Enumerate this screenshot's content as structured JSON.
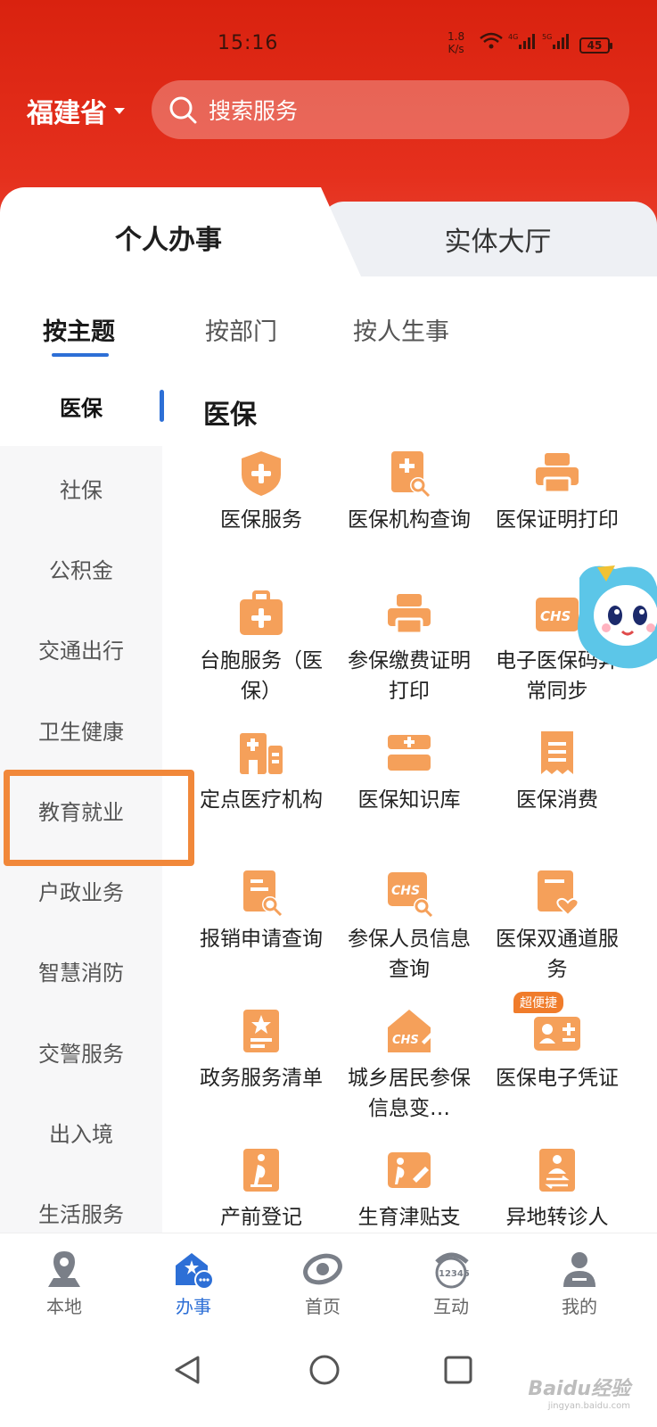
{
  "status": {
    "time": "15:16",
    "speed_top": "1.8",
    "speed_bottom": "K/s",
    "battery": "45"
  },
  "header": {
    "province": "福建省",
    "search_placeholder": "搜索服务"
  },
  "top_tabs": {
    "personal": "个人办事",
    "hall": "实体大厅"
  },
  "sub_tabs": [
    "按主题",
    "按部门",
    "按人生事"
  ],
  "sidebar": [
    "医保",
    "社保",
    "公积金",
    "交通出行",
    "卫生健康",
    "教育就业",
    "户政业务",
    "智慧消防",
    "交警服务",
    "出入境",
    "生活服务"
  ],
  "section_title": "医保",
  "services": [
    {
      "label": "医保服务",
      "icon": "shield-plus-icon"
    },
    {
      "label": "医保机构查询",
      "icon": "document-search-icon"
    },
    {
      "label": "医保证明打印",
      "icon": "printer-icon"
    },
    {
      "label": "台胞服务（医保）",
      "icon": "medical-kit-icon"
    },
    {
      "label": "参保缴费证明打印",
      "icon": "printer-icon"
    },
    {
      "label": "电子医保码异常同步",
      "icon": "chs-card-icon"
    },
    {
      "label": "定点医疗机构",
      "icon": "hospital-icon"
    },
    {
      "label": "医保知识库",
      "icon": "book-stack-icon"
    },
    {
      "label": "医保消费",
      "icon": "receipt-icon"
    },
    {
      "label": "报销申请查询",
      "icon": "document-search-icon"
    },
    {
      "label": "参保人员信息查询",
      "icon": "chs-search-icon"
    },
    {
      "label": "医保双通道服务",
      "icon": "document-heart-icon"
    },
    {
      "label": "政务服务清单",
      "icon": "star-list-icon"
    },
    {
      "label": "城乡居民参保信息变…",
      "icon": "chs-edit-icon"
    },
    {
      "label": "医保电子凭证",
      "icon": "id-card-icon",
      "badge": "超便捷"
    },
    {
      "label": "产前登记",
      "icon": "pregnancy-icon"
    },
    {
      "label": "生育津贴支",
      "icon": "pregnancy-edit-icon"
    },
    {
      "label": "异地转诊人",
      "icon": "person-transfer-icon"
    }
  ],
  "bottom_nav": [
    "本地",
    "办事",
    "首页",
    "互动",
    "我的"
  ],
  "watermark": {
    "main": "Baidu经验",
    "sub": "jingyan.baidu.com"
  },
  "colors": {
    "header_red": "#d9220f",
    "accent_blue": "#2d6fd6",
    "icon_orange": "#f5a05a",
    "highlight_orange": "#f1883a"
  }
}
